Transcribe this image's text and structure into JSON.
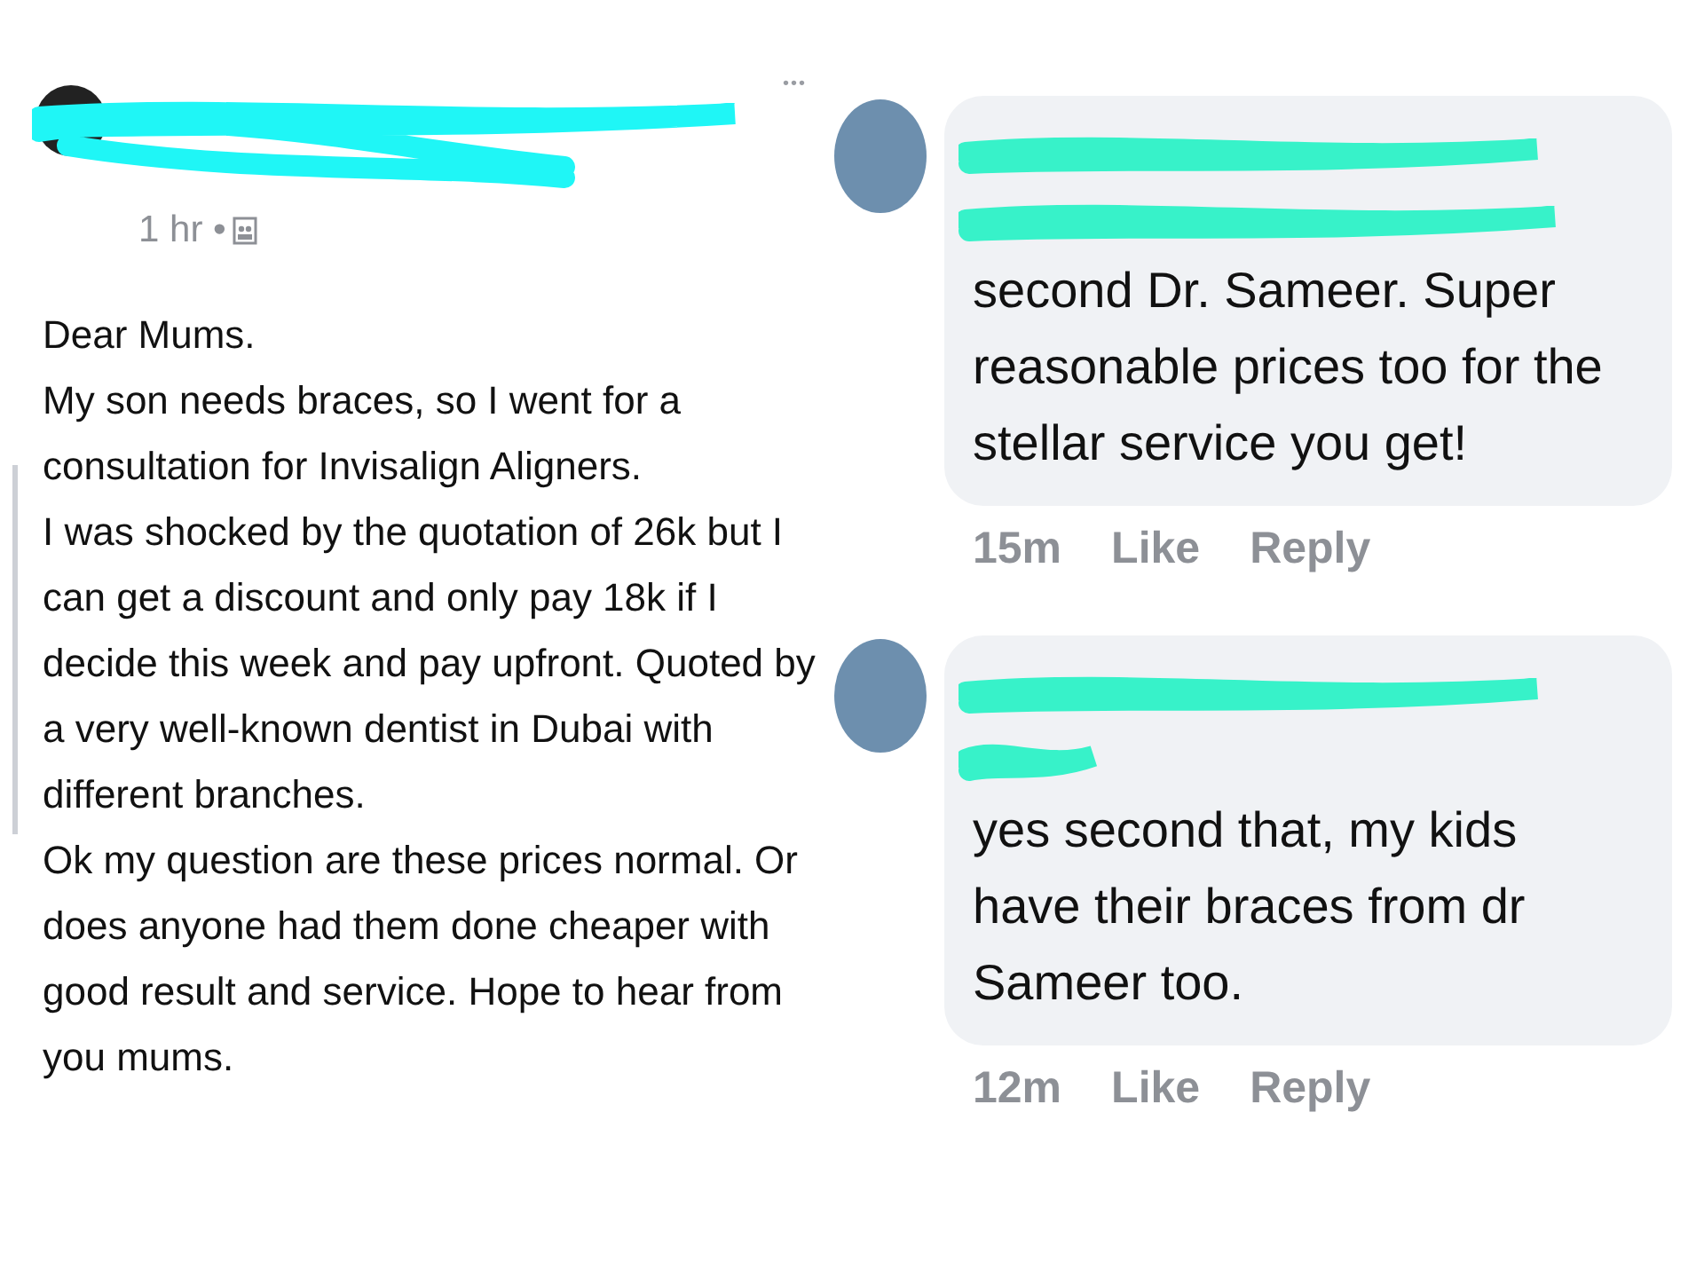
{
  "post": {
    "time": "1 hr •",
    "more": "•••",
    "paragraphs": [
      "Dear Mums.",
      "My son needs braces, so I went for a consultation for Invisalign Aligners.",
      "I was shocked by the quotation of 26k but I can get a discount and only pay 18k if I decide this week and pay upfront. Quoted by a very well-known dentist in Dubai with different branches.",
      "Ok my question are these prices normal. Or does anyone had them done cheaper with good result and service. Hope to hear from you mums."
    ]
  },
  "comments": [
    {
      "text": "second Dr. Sameer. Super reasonable prices too for the stellar service you get!",
      "time": "15m",
      "actions": [
        "Like",
        "Reply"
      ]
    },
    {
      "text": "yes second that, my kids have their braces from dr Sameer too.",
      "time": "12m",
      "actions": [
        "Like",
        "Reply"
      ]
    }
  ]
}
